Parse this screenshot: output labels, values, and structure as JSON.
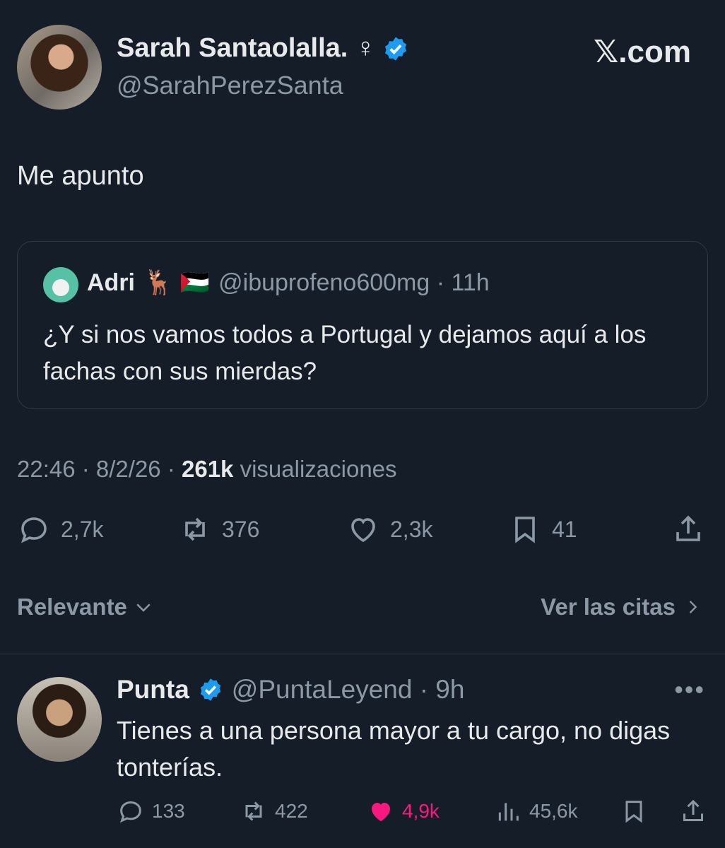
{
  "tweet": {
    "author_name": "Sarah Santaolalla. ♀",
    "author_handle": "@SarahPerezSanta",
    "brand": "𝕏.com",
    "text": "Me apunto",
    "quoted": {
      "name": "Adri",
      "emoji": "🦌 🇵🇸",
      "handle": "@ibuprofeno600mg · 11h",
      "text": "¿Y si nos vamos todos a Portugal y dejamos aquí a los fachas con sus mierdas?"
    },
    "meta_time": "22:46 · 8/2/26 ·",
    "meta_views_count": "261k",
    "meta_views_label": "visualizaciones",
    "stats": {
      "replies": "2,7k",
      "retweets": "376",
      "likes": "2,3k",
      "bookmarks": "41"
    }
  },
  "sort": {
    "label": "Relevante",
    "quotes_link": "Ver las citas"
  },
  "reply": {
    "name": "Punta",
    "handle": "@PuntaLeyend · 9h",
    "text": "Tienes a una persona mayor a tu cargo, no digas tonterías.",
    "stats": {
      "replies": "133",
      "retweets": "422",
      "likes": "4,9k",
      "views": "45,6k"
    }
  },
  "colors": {
    "background": "#151d28",
    "verified": "#1d9bf0",
    "like": "#f91880",
    "muted": "#8b98a5"
  }
}
